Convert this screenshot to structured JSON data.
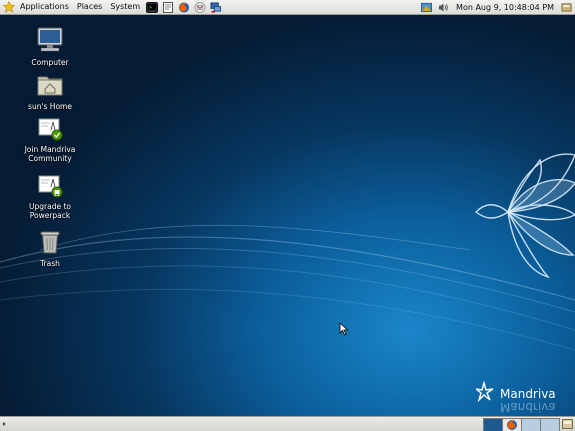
{
  "top_panel": {
    "menus": [
      "Applications",
      "Places",
      "System"
    ],
    "launchers": [
      "terminal-icon",
      "text-editor-icon",
      "firefox-icon",
      "mail-icon",
      "network-icon"
    ],
    "clock": "Mon Aug  9, 10:48:04 PM",
    "tray": [
      "update-notifier-icon",
      "volume-icon",
      "fast-user-switch-icon"
    ]
  },
  "desktop_icons": [
    {
      "label": "Computer",
      "icon": "computer-icon"
    },
    {
      "label": "sun's Home",
      "icon": "home-folder-icon"
    },
    {
      "label": "Join Mandriva Community",
      "icon": "join-community-icon"
    },
    {
      "label": "Upgrade to Powerpack",
      "icon": "upgrade-icon"
    },
    {
      "label": "Trash",
      "icon": "trash-icon"
    }
  ],
  "wallpaper": {
    "brand": "Mandriva",
    "colors": {
      "deep": "#051b33",
      "mid": "#0b5f9c",
      "glow": "#1a86c8"
    }
  },
  "bottom_panel": {
    "workspaces": [
      "workspace-1",
      "workspace-2",
      "workspace-3",
      "workspace-4"
    ],
    "active_workspace": 1,
    "right_icons": [
      "show-desktop-icon"
    ]
  }
}
